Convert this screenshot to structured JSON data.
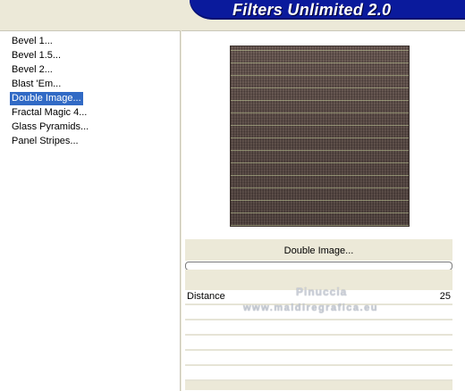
{
  "window": {
    "title": "Filters Unlimited 2.0"
  },
  "filters": {
    "items": [
      {
        "label": "Bevel 1..."
      },
      {
        "label": "Bevel 1.5..."
      },
      {
        "label": "Bevel 2..."
      },
      {
        "label": "Blast 'Em..."
      },
      {
        "label": "Double Image..."
      },
      {
        "label": "Fractal Magic 4..."
      },
      {
        "label": "Glass Pyramids..."
      },
      {
        "label": "Panel Stripes..."
      }
    ],
    "selected": "Double Image..."
  },
  "preview": {
    "filter_name": "Double Image...",
    "progress": 0
  },
  "controls": [
    {
      "label": "Distance",
      "value": "25"
    }
  ],
  "watermark": {
    "name": "Pinuccia",
    "url": "www.maldiregrafica.eu"
  },
  "colors": {
    "banner": "#0a1a9c",
    "selection": "#316ac5",
    "dialog_bg": "#ece9d8"
  }
}
